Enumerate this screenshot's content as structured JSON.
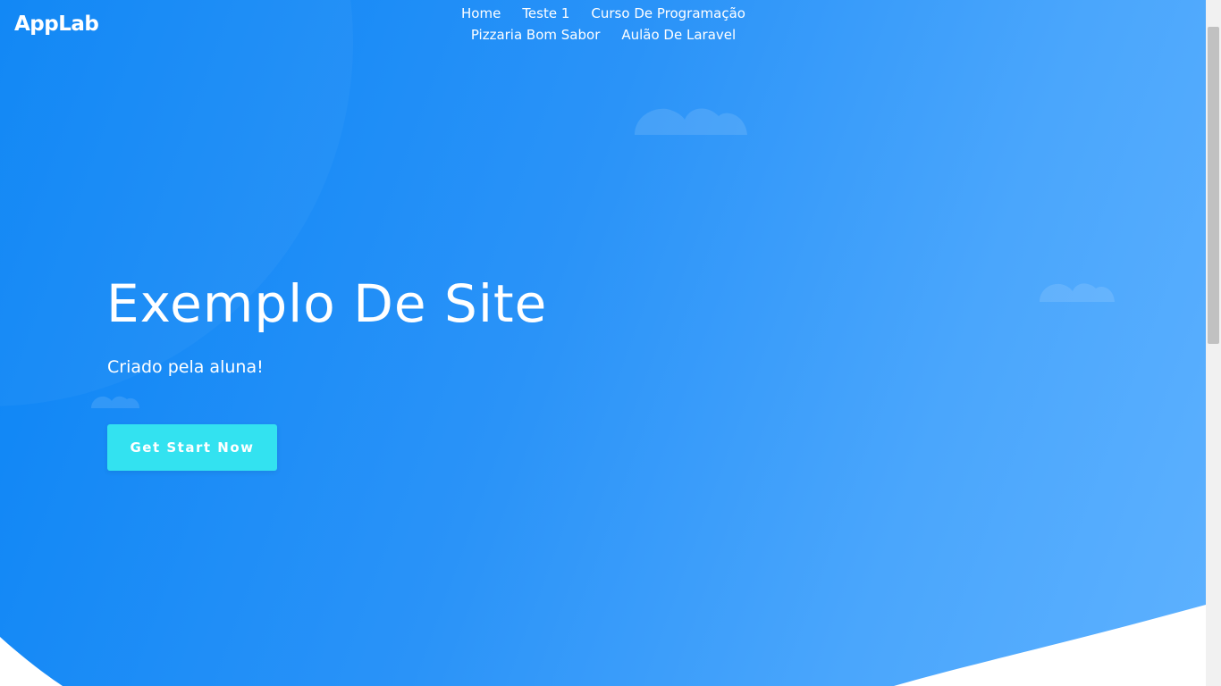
{
  "brand": {
    "name": "AppLab"
  },
  "nav": {
    "items": [
      {
        "label": "Home"
      },
      {
        "label": "Teste 1"
      },
      {
        "label": "Curso De Programação"
      },
      {
        "label": "Pizzaria Bom Sabor"
      },
      {
        "label": "Aulão De Laravel"
      }
    ]
  },
  "hero": {
    "title": "Exemplo De Site",
    "subtitle": "Criado pela aluna!",
    "cta_label": "Get Start Now"
  },
  "colors": {
    "gradient_start": "#0a84f5",
    "gradient_end": "#5db1ff",
    "cta_background": "#33e2f0",
    "text": "#ffffff"
  },
  "icons": [
    "cloud-icon"
  ]
}
